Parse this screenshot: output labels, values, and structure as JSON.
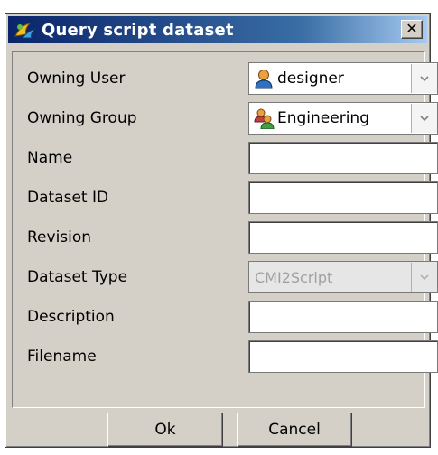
{
  "window": {
    "title": "Query script dataset"
  },
  "fields": {
    "owning_user": {
      "label": "Owning User",
      "value": "designer"
    },
    "owning_group": {
      "label": "Owning Group",
      "value": "Engineering"
    },
    "name": {
      "label": "Name",
      "value": ""
    },
    "dataset_id": {
      "label": "Dataset ID",
      "value": ""
    },
    "revision": {
      "label": "Revision",
      "value": ""
    },
    "dataset_type": {
      "label": "Dataset Type",
      "value": "CMI2Script"
    },
    "description": {
      "label": "Description",
      "value": ""
    },
    "filename": {
      "label": "Filename",
      "value": ""
    }
  },
  "buttons": {
    "ok": "Ok",
    "cancel": "Cancel"
  },
  "icons": {
    "app": "query-dataset-icon",
    "user": "user-icon",
    "group": "group-icon",
    "close": "close-icon",
    "dropdown": "chevron-down-icon"
  }
}
